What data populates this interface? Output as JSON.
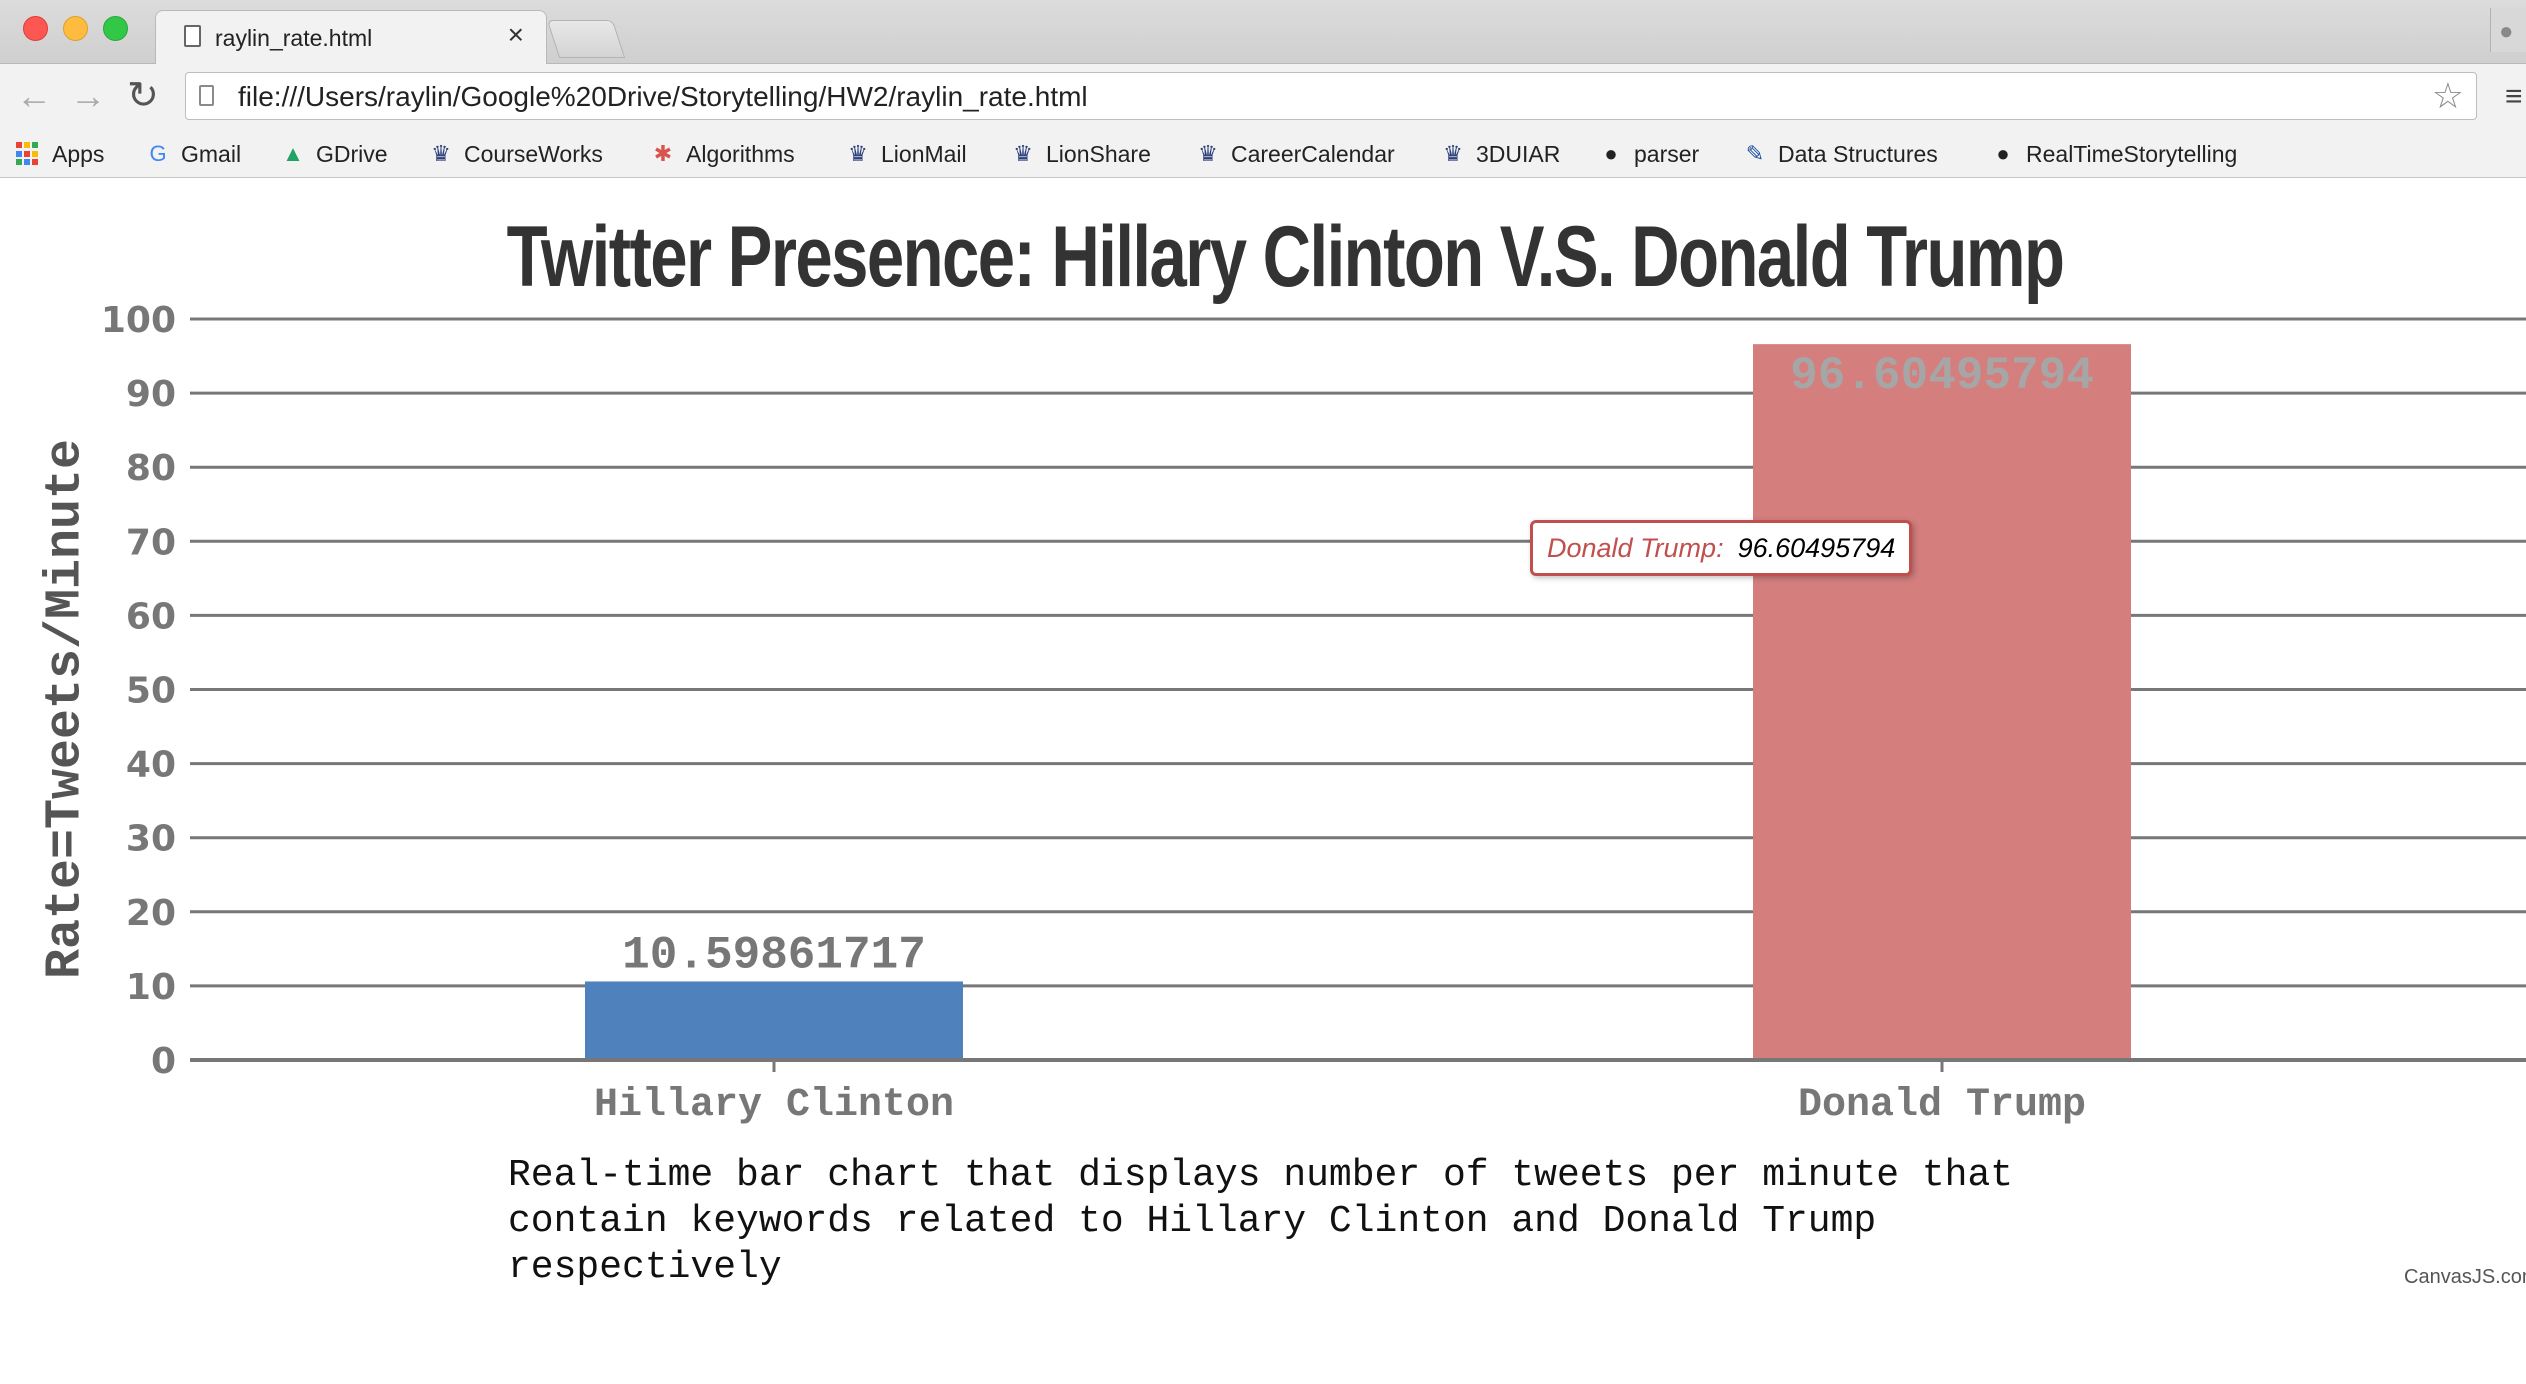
{
  "browser": {
    "tab": {
      "title": "raylin_rate.html",
      "close": "×"
    },
    "nav": {
      "back": "←",
      "forward": "→",
      "reload": "↻"
    },
    "url": "file:///Users/raylin/Google%20Drive/Storytelling/HW2/raylin_rate.html",
    "bookmarks": [
      {
        "label": "Apps",
        "icon": "apps-grid-icon"
      },
      {
        "label": "Gmail",
        "icon": "google-icon"
      },
      {
        "label": "GDrive",
        "icon": "drive-icon"
      },
      {
        "label": "CourseWorks",
        "icon": "crown-icon"
      },
      {
        "label": "Algorithms",
        "icon": "pinwheel-icon"
      },
      {
        "label": "LionMail",
        "icon": "crown-icon"
      },
      {
        "label": "LionShare",
        "icon": "crown-icon"
      },
      {
        "label": "CareerCalendar",
        "icon": "crown-icon"
      },
      {
        "label": "3DUIAR",
        "icon": "crown-icon"
      },
      {
        "label": "parser",
        "icon": "github-icon"
      },
      {
        "label": "Data Structures",
        "icon": "pencil-icon"
      },
      {
        "label": "RealTimeStorytelling",
        "icon": "github-icon"
      }
    ]
  },
  "page": {
    "caption": "Real-time bar chart that displays number of tweets per minute that contain keywords related to Hillary Clinton and Donald Trump respectively",
    "credit": "CanvasJS.com",
    "tooltip": {
      "label": "Donald Trump:",
      "value": "96.60495794"
    }
  },
  "chart_data": {
    "type": "bar",
    "title": "Twitter Presence: Hillary Clinton V.S. Donald Trump",
    "ylabel": "Rate=Tweets/Minute",
    "xlabel": "",
    "ylim": [
      0,
      100
    ],
    "yticks": [
      "0",
      "10",
      "20",
      "30",
      "40",
      "50",
      "60",
      "70",
      "80",
      "90",
      "100"
    ],
    "grid": true,
    "categories": [
      "Hillary Clinton",
      "Donald Trump"
    ],
    "values": [
      10.59861717,
      96.60495794
    ],
    "data_labels": [
      "10.59861717",
      "96.60495794"
    ],
    "colors": [
      "#4f81bc",
      "#d47e7e"
    ]
  }
}
